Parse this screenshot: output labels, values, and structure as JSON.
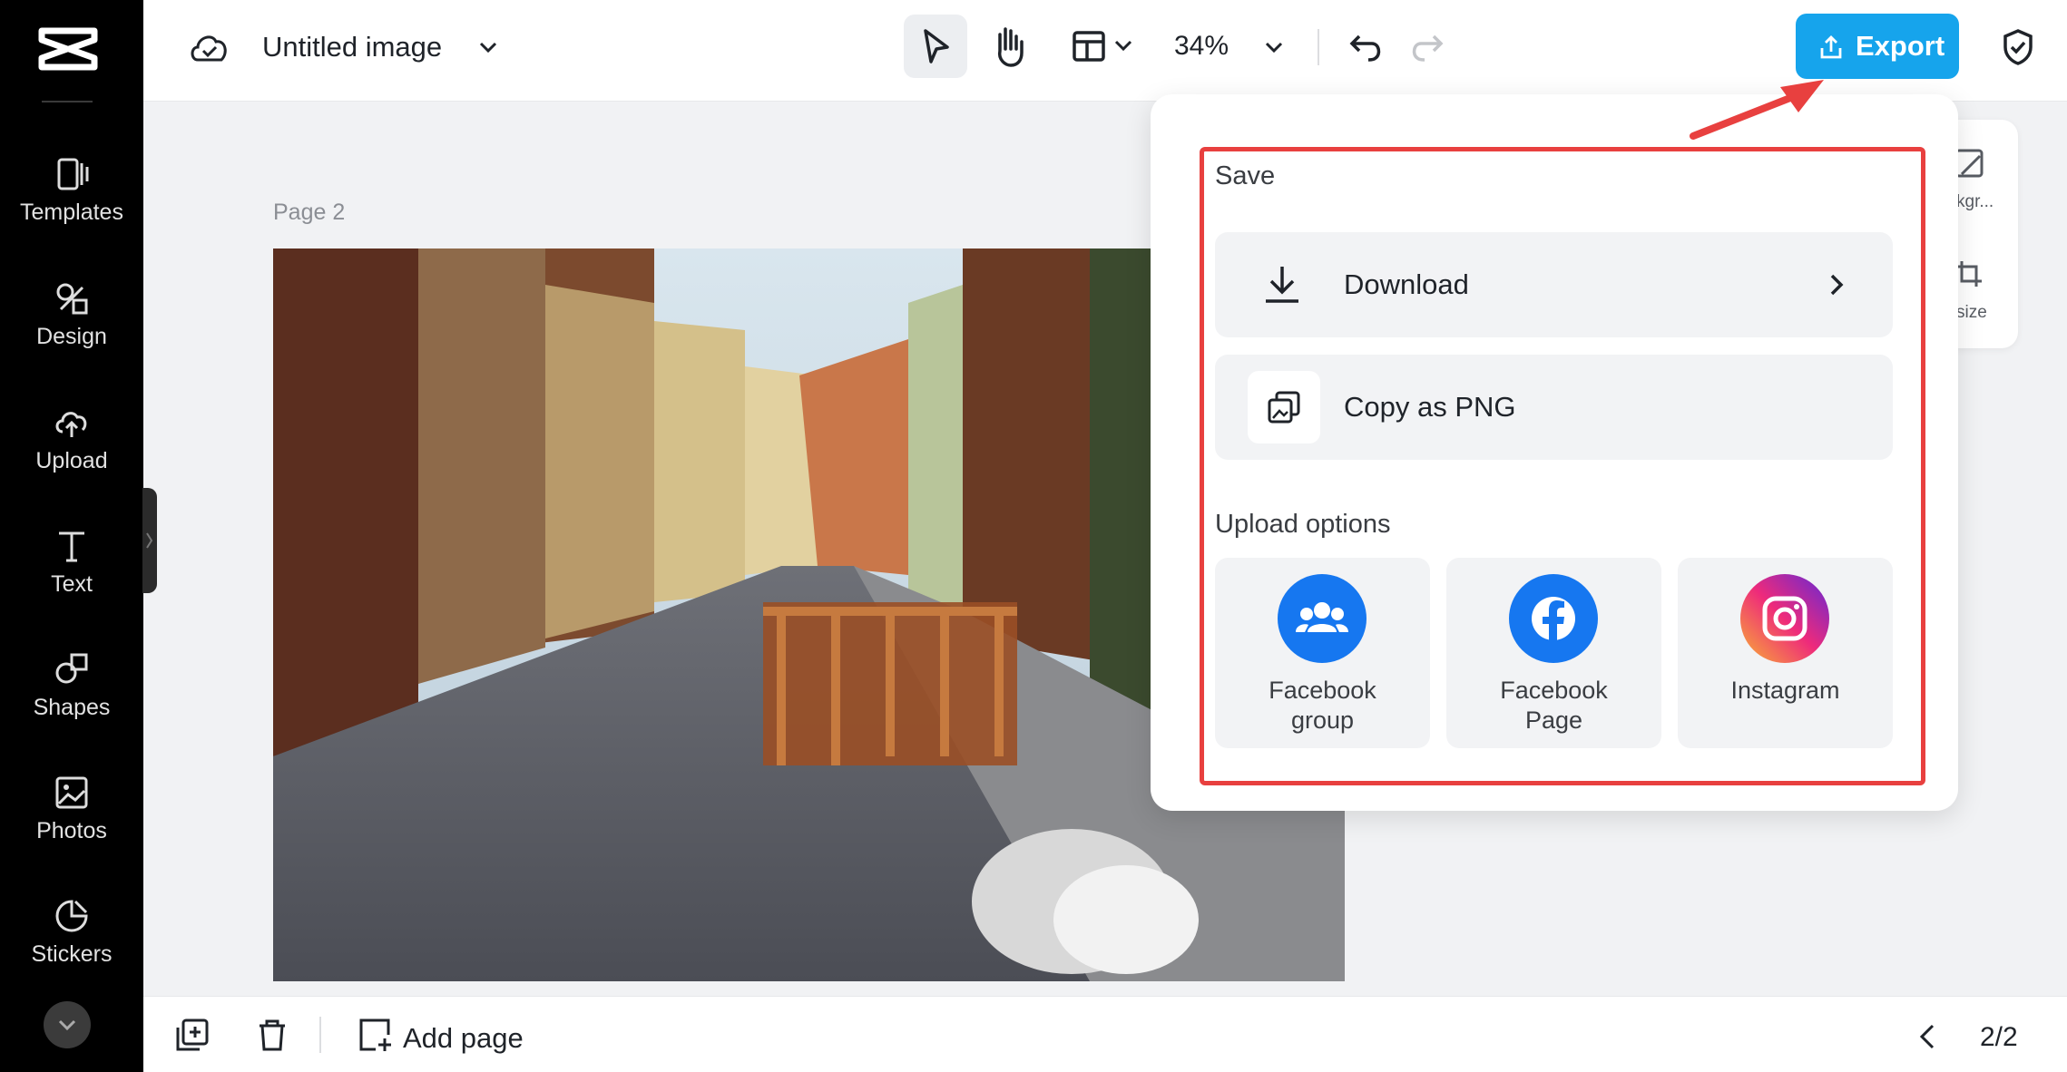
{
  "sidebar": {
    "items": [
      {
        "label": "Templates",
        "icon": "templates-icon"
      },
      {
        "label": "Design",
        "icon": "design-icon"
      },
      {
        "label": "Upload",
        "icon": "upload-cloud-icon"
      },
      {
        "label": "Text",
        "icon": "text-icon"
      },
      {
        "label": "Shapes",
        "icon": "shapes-icon"
      },
      {
        "label": "Photos",
        "icon": "photos-icon"
      },
      {
        "label": "Stickers",
        "icon": "stickers-icon"
      }
    ]
  },
  "header": {
    "title": "Untitled image",
    "zoom": "34%",
    "export_label": "Export"
  },
  "canvas": {
    "page_label": "Page 2"
  },
  "right_panel": {
    "item1_label": "kgr...",
    "item2_label": "size"
  },
  "export_menu": {
    "save_title": "Save",
    "download_label": "Download",
    "copy_label": "Copy as PNG",
    "upload_title": "Upload options",
    "options": [
      {
        "line1": "Facebook",
        "line2": "group",
        "icon": "facebook-group-icon",
        "color": "#1677f0"
      },
      {
        "line1": "Facebook",
        "line2": "Page",
        "icon": "facebook-icon",
        "color": "#1677f0"
      },
      {
        "line1": "Instagram",
        "line2": "",
        "icon": "instagram-icon",
        "color": "#e1306c"
      }
    ]
  },
  "footer": {
    "add_page_label": "Add page",
    "pager": "2/2"
  },
  "colors": {
    "accent": "#16a4ec",
    "highlight": "#e8403f",
    "sidebar_bg": "#000000"
  }
}
